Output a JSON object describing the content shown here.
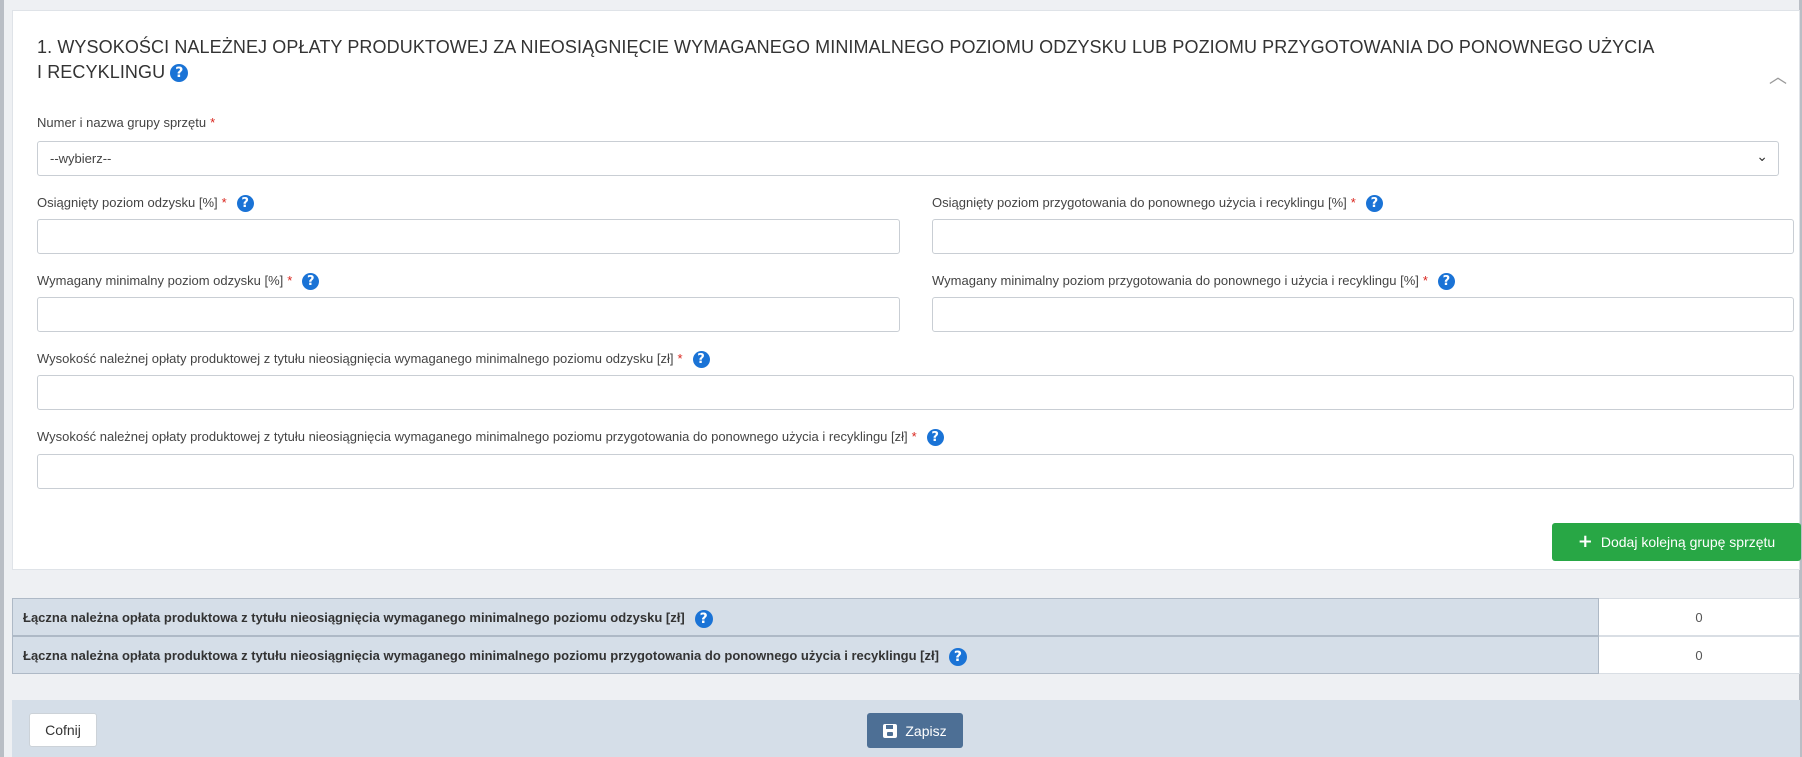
{
  "section": {
    "title": "1. WYSOKOŚCI NALEŻNEJ OPŁATY PRODUKTOWEJ ZA NIEOSIĄGNIĘCIE WYMAGANEGO MINIMALNEGO POZIOMU ODZYSKU LUB POZIOMU PRZYGOTOWANIA DO PONOWNEGO UŻYCIA I RECYKLINGU",
    "help_icon": "?",
    "collapse_icon": "chevron-up"
  },
  "fields": {
    "group": {
      "label": "Numer i nazwa grupy sprzętu",
      "value": "--wybierz--"
    },
    "recovery_achieved": {
      "label": "Osiągnięty poziom odzysku [%]",
      "value": ""
    },
    "recycling_achieved": {
      "label": "Osiągnięty poziom przygotowania do ponownego użycia i recyklingu [%]",
      "value": ""
    },
    "recovery_required": {
      "label": "Wymagany minimalny poziom odzysku [%]",
      "value": ""
    },
    "recycling_required": {
      "label": "Wymagany minimalny poziom przygotowania do ponownego i użycia i recyklingu [%]",
      "value": ""
    },
    "fee_recovery": {
      "label": "Wysokość należnej opłaty produktowej z tytułu nieosiągnięcia wymaganego minimalnego poziomu odzysku [zł]",
      "value": ""
    },
    "fee_recycling": {
      "label": "Wysokość należnej opłaty produktowej z tytułu nieosiągnięcia wymaganego minimalnego poziomu przygotowania do ponownego użycia i recyklingu [zł]",
      "value": ""
    }
  },
  "required_mark": "*",
  "add_group_button": "Dodaj kolejną grupę sprzętu",
  "summary": [
    {
      "label": "Łączna należna opłata produktowa z tytułu nieosiągnięcia wymaganego minimalnego poziomu odzysku [zł]",
      "value": "0"
    },
    {
      "label": "Łączna należna opłata produktowa z tytułu nieosiągnięcia wymaganego minimalnego poziomu przygotowania do ponownego użycia i recyklingu [zł]",
      "value": "0"
    }
  ],
  "footer": {
    "back_label": "Cofnij",
    "save_label": "Zapisz"
  },
  "colors": {
    "accent_blue": "#1a73d6",
    "add_green": "#28a745",
    "save_blue": "#4d6f95",
    "required_red": "#d9251d"
  }
}
